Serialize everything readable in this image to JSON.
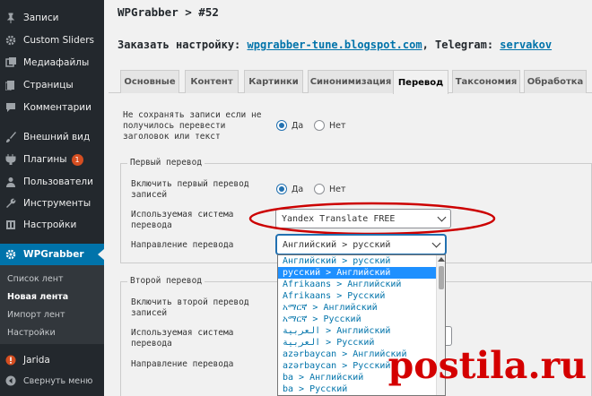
{
  "sidebar": {
    "items": [
      {
        "label": "Записи",
        "icon": "pin-icon"
      },
      {
        "label": "Custom Sliders",
        "icon": "gear-icon"
      },
      {
        "label": "Медиафайлы",
        "icon": "media-icon"
      },
      {
        "label": "Страницы",
        "icon": "pages-icon"
      },
      {
        "label": "Комментарии",
        "icon": "comment-icon"
      },
      {
        "label": "Внешний вид",
        "icon": "brush-icon"
      },
      {
        "label": "Плагины",
        "icon": "plugin-icon",
        "badge": "1"
      },
      {
        "label": "Пользователи",
        "icon": "users-icon"
      },
      {
        "label": "Инструменты",
        "icon": "wrench-icon"
      },
      {
        "label": "Настройки",
        "icon": "settings-icon"
      },
      {
        "label": "WPGrabber",
        "icon": "gear-icon",
        "active": true
      }
    ],
    "submenu": [
      "Список лент",
      "Новая лента",
      "Импорт лент",
      "Настройки"
    ],
    "bottom": [
      {
        "label": "Jarida",
        "icon": "info-icon"
      },
      {
        "label": "Свернуть меню",
        "icon": "collapse-icon"
      }
    ]
  },
  "header": {
    "title": "WPGrabber > #52",
    "tune_prefix": "Заказать настройку: ",
    "tune_link": "wpgrabber-tune.blogspot.com",
    "tune_middle": ", Telegram: ",
    "telegram_link": "servakov"
  },
  "tabs": [
    "Основные",
    "Контент",
    "Картинки",
    "Синонимизация",
    "Перевод",
    "Таксономия",
    "Обработка"
  ],
  "active_tab": "Перевод",
  "form": {
    "no_save_label": "Не сохранять записи если не получилось перевести заголовок или текст",
    "yes": "Да",
    "no": "Нет",
    "first_section": "Первый перевод",
    "enable_first": "Включить первый перевод записей",
    "system_label": "Используемая система перевода",
    "system_value": "Yandex Translate FREE",
    "direction_label": "Направление перевода",
    "direction_value": "Английский > русский",
    "second_section": "Второй перевод",
    "enable_second": "Включить второй перевод записей",
    "system2_label": "Используемая система перевода",
    "direction2_label": "Направление перевода"
  },
  "dropdown_options": [
    "Английский > русский",
    "русский > Английский",
    "Afrikaans > Английский",
    "Afrikaans > Русский",
    "አማርኛ > Английский",
    "አማርኛ > Русский",
    "العربية > Английский",
    "العربية > Русский",
    "azərbaycan > Английский",
    "azərbaycan > Русский",
    "ba > Английский",
    "ba > Русский"
  ],
  "selected_option_index": 1,
  "watermark": "postila.ru",
  "colors": {
    "sidebar_bg": "#23282d",
    "accent": "#0073aa",
    "badge": "#d54e21",
    "highlight_oval": "#cc0000",
    "option_selected": "#1e90ff",
    "watermark": "#d40000"
  }
}
